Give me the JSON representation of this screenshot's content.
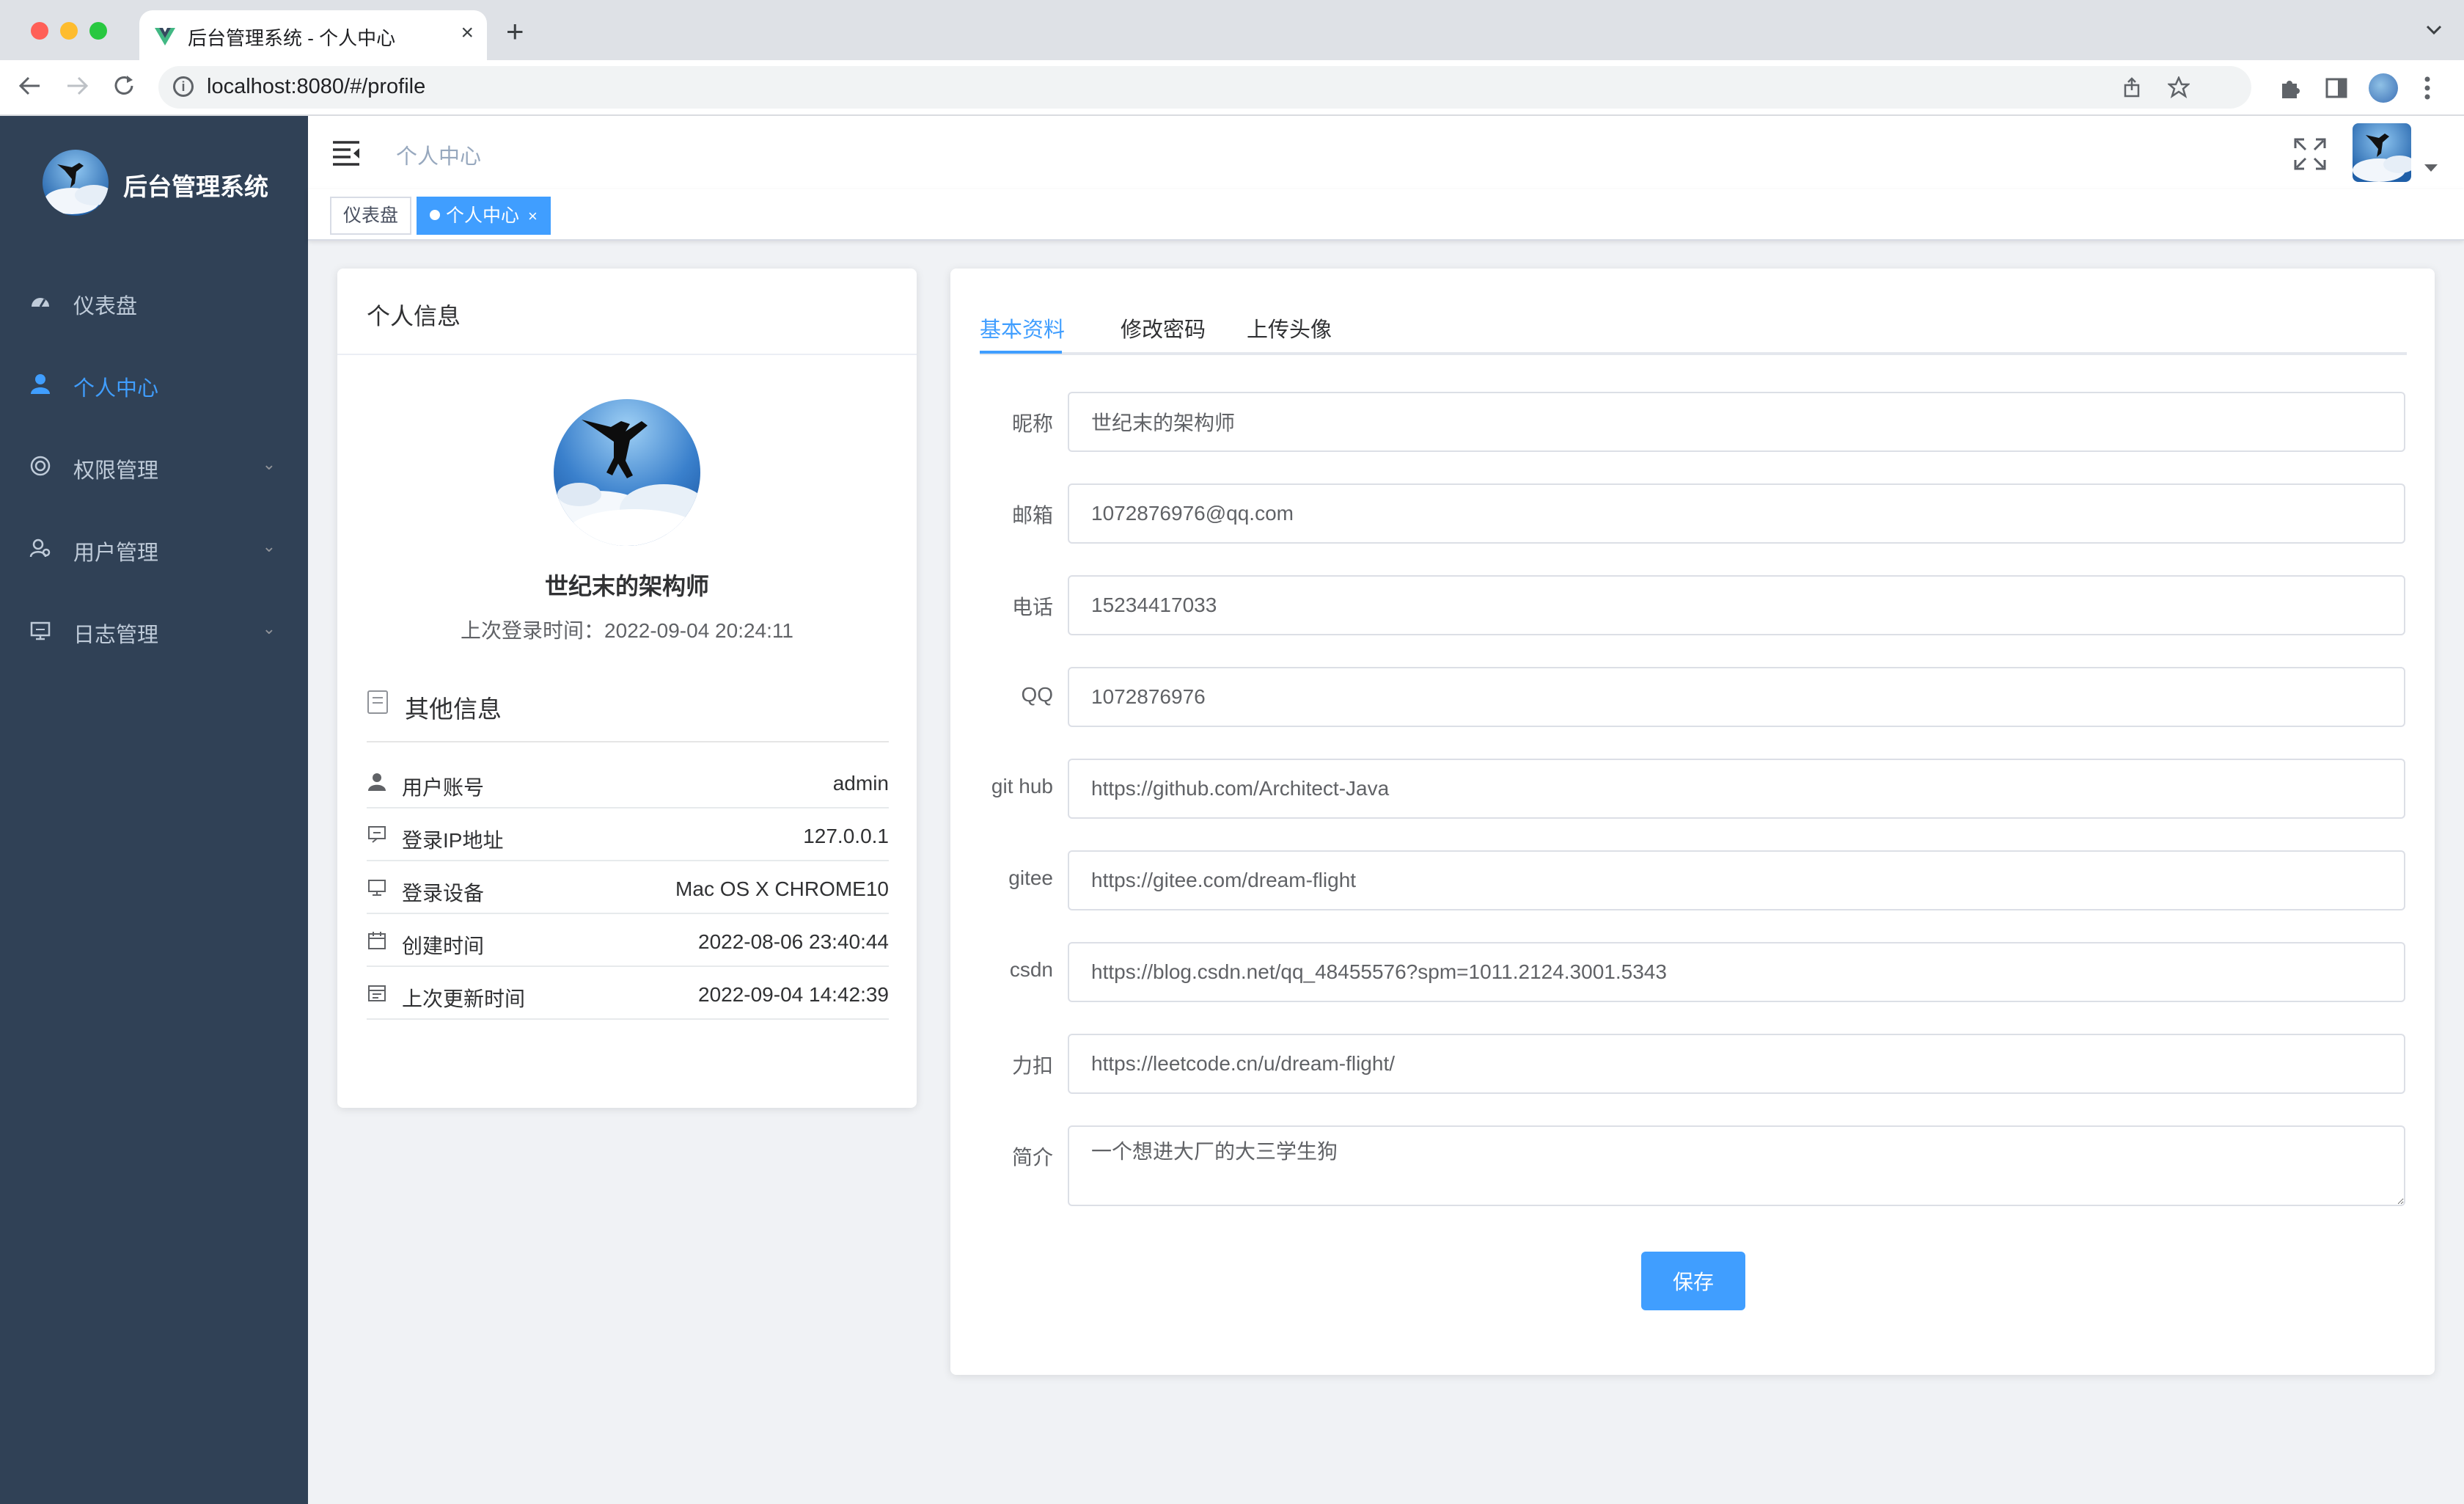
{
  "browser": {
    "tab_title": "后台管理系统 - 个人中心",
    "tab_close": "×",
    "new_tab": "+",
    "url": "localhost:8080/#/profile"
  },
  "app": {
    "title": "后台管理系统",
    "sidebar": {
      "items": [
        {
          "label": "仪表盘",
          "icon": "dashboard-icon",
          "active": false
        },
        {
          "label": "个人中心",
          "icon": "user-icon",
          "active": true
        },
        {
          "label": "权限管理",
          "icon": "permission-icon",
          "active": false,
          "arrow": "⌄"
        },
        {
          "label": "用户管理",
          "icon": "users-icon",
          "active": false,
          "arrow": "⌄"
        },
        {
          "label": "日志管理",
          "icon": "log-icon",
          "active": false,
          "arrow": "⌄"
        }
      ]
    },
    "accent_color": "#409eff",
    "sidebar_color": "#304156"
  },
  "navbar": {
    "breadcrumb": "个人中心"
  },
  "tags": [
    {
      "label": "仪表盘",
      "active": false
    },
    {
      "label": "个人中心",
      "active": true,
      "close": "×"
    }
  ],
  "profile": {
    "title": "个人信息",
    "name": "世纪末的架构师",
    "last_login_label": "上次登录时间：",
    "last_login_value": "2022-09-04 20:24:11",
    "other_info_title": "其他信息",
    "rows": [
      {
        "icon": "person-icon",
        "label": "用户账号",
        "value": "admin"
      },
      {
        "icon": "ip-icon",
        "label": "登录IP地址",
        "value": "127.0.0.1"
      },
      {
        "icon": "monitor-icon",
        "label": "登录设备",
        "value": "Mac OS X CHROME10"
      },
      {
        "icon": "calendar-icon",
        "label": "创建时间",
        "value": "2022-08-06 23:40:44"
      },
      {
        "icon": "update-icon",
        "label": "上次更新时间",
        "value": "2022-09-04 14:42:39"
      }
    ]
  },
  "form": {
    "tabs": [
      "基本资料",
      "修改密码",
      "上传头像"
    ],
    "active_tab": 0,
    "fields": [
      {
        "label": "昵称",
        "value": "世纪末的架构师"
      },
      {
        "label": "邮箱",
        "value": "1072876976@qq.com"
      },
      {
        "label": "电话",
        "value": "15234417033"
      },
      {
        "label": "QQ",
        "value": "1072876976"
      },
      {
        "label": "git hub",
        "value": "https://github.com/Architect-Java"
      },
      {
        "label": "gitee",
        "value": "https://gitee.com/dream-flight"
      },
      {
        "label": "csdn",
        "value": "https://blog.csdn.net/qq_48455576?spm=1011.2124.3001.5343"
      },
      {
        "label": "力扣",
        "value": "https://leetcode.cn/u/dream-flight/"
      }
    ],
    "bio_label": "简介",
    "bio_value": "一个想进大厂的大三学生狗",
    "save_label": "保存"
  }
}
